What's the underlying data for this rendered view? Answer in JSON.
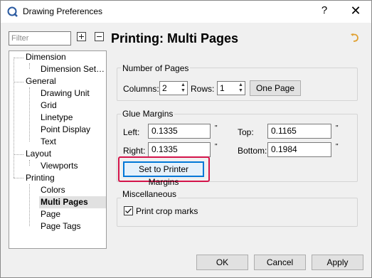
{
  "window": {
    "title": "Drawing Preferences",
    "help_label": "?",
    "close_label": "✕"
  },
  "sidebar": {
    "filter_placeholder": "Filter",
    "tree": [
      {
        "label": "Dimension",
        "level": 0
      },
      {
        "label": "Dimension Set…",
        "level": 1
      },
      {
        "label": "General",
        "level": 0
      },
      {
        "label": "Drawing Unit",
        "level": 1
      },
      {
        "label": "Grid",
        "level": 1
      },
      {
        "label": "Linetype",
        "level": 1
      },
      {
        "label": "Point Display",
        "level": 1
      },
      {
        "label": "Text",
        "level": 1
      },
      {
        "label": "Layout",
        "level": 0
      },
      {
        "label": "Viewports",
        "level": 1
      },
      {
        "label": "Printing",
        "level": 0
      },
      {
        "label": "Colors",
        "level": 1
      },
      {
        "label": "Multi Pages",
        "level": 1,
        "selected": true
      },
      {
        "label": "Page",
        "level": 1
      },
      {
        "label": "Page Tags",
        "level": 1
      }
    ]
  },
  "main": {
    "title": "Printing: Multi Pages",
    "number_of_pages": {
      "title": "Number of Pages",
      "columns_label": "Columns:",
      "columns_value": "2",
      "rows_label": "Rows:",
      "rows_value": "1",
      "one_page_label": "One Page"
    },
    "glue_margins": {
      "title": "Glue Margins",
      "left_label": "Left:",
      "left_value": "0.1335",
      "top_label": "Top:",
      "top_value": "0.1165",
      "right_label": "Right:",
      "right_value": "0.1335",
      "bottom_label": "Bottom:",
      "bottom_value": "0.1984",
      "unit": "\"",
      "printer_margins_label": "Set to Printer Margins"
    },
    "miscellaneous": {
      "title": "Miscellaneous",
      "crop_marks_label": "Print crop marks",
      "crop_marks_checked": true
    }
  },
  "footer": {
    "ok_label": "OK",
    "cancel_label": "Cancel",
    "apply_label": "Apply"
  },
  "colors": {
    "highlight": "#d4144a",
    "focus": "#0078d7",
    "reset_icon": "#e0a030"
  }
}
